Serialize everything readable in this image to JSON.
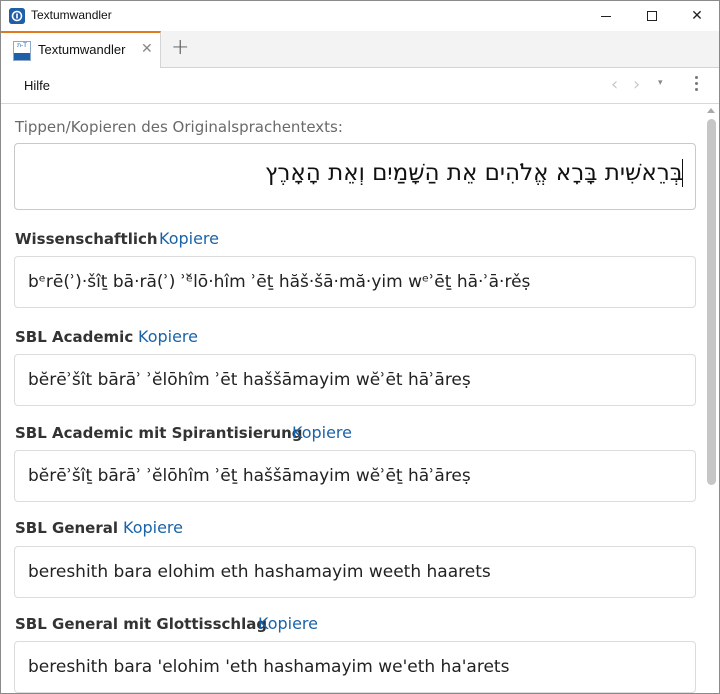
{
  "window": {
    "title": "Textumwandler",
    "controls": {
      "minimize": "minimize",
      "maximize": "maximize",
      "close": "✕"
    }
  },
  "tabs": [
    {
      "label": "Textumwandler",
      "icon": "textumwandler-icon",
      "close": "✕"
    }
  ],
  "tab_add": "+",
  "menu": {
    "items": [
      "Hilfe"
    ]
  },
  "nav": {
    "back": "‹",
    "forward": "›",
    "dropdown": "▾"
  },
  "source": {
    "prompt": "Tippen/Kopieren des Originalsprachentexts:",
    "value": "בְּרֵאשִׁית בָּרָא אֱלֹהִים אֵת הַשָּׁמַיִם וְאֵת הָאָרֶץ"
  },
  "copy_label": "Kopiere",
  "sections": [
    {
      "title": "Wissenschaftlich",
      "copy": "Kopiere",
      "text": "bᵉrē(ʾ)·šîṯ bā·rā(ʾ) ʾᵉ̆lō·hîm ʾēṯ hăš·šā·mă·yim wᵉʾēṯ hā·ʾā·rěṣ"
    },
    {
      "title": "SBL Academic",
      "copy": "Kopiere",
      "text": "bĕrēʾšît bārāʾ ʾĕlōhîm ʾēt haššāmayim wĕʾēt hāʾāreṣ"
    },
    {
      "title": "SBL Academic mit Spirantisierung",
      "copy": "Kopiere",
      "text": "bĕrēʾšîṯ bārāʾ ʾĕlōhîm ʾēṯ haššāmayim wĕʾēṯ hāʾāreṣ"
    },
    {
      "title": "SBL General",
      "copy": "Kopiere",
      "text": "bereshith bara elohim eth hashamayim weeth haarets"
    },
    {
      "title": "SBL General mit Glottisschlag",
      "copy": "Kopiere",
      "text": "bereshith bara 'elohim 'eth hashamayim we'eth ha'arets"
    }
  ],
  "colors": {
    "accent_tab": "#e07a20",
    "link": "#1a63a8",
    "app_icon": "#1f5fa8"
  }
}
